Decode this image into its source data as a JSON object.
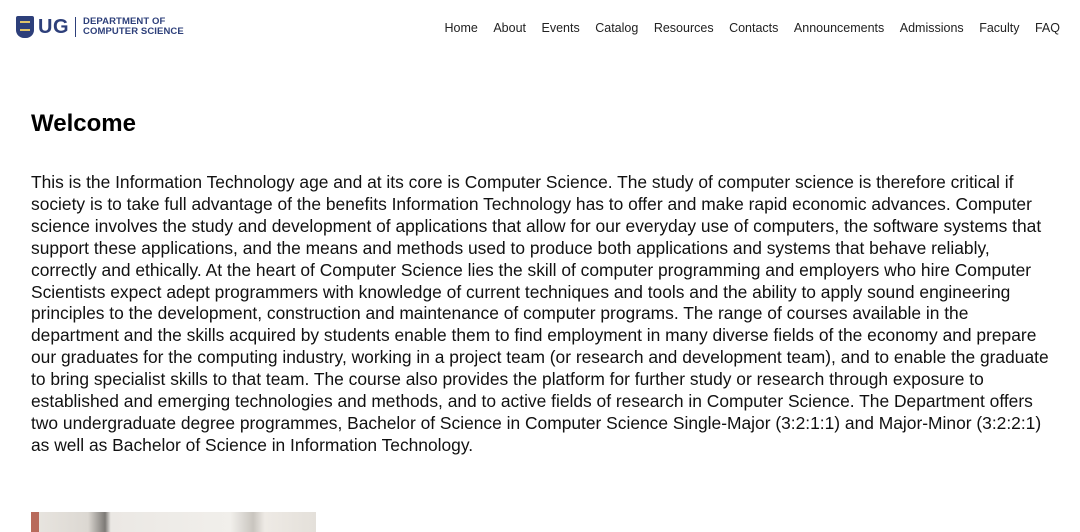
{
  "header": {
    "logo_mark": "UG",
    "logo_line1": "DEPARTMENT OF",
    "logo_line2": "COMPUTER SCIENCE",
    "nav": [
      {
        "label": "Home"
      },
      {
        "label": "About"
      },
      {
        "label": "Events"
      },
      {
        "label": "Catalog"
      },
      {
        "label": "Resources"
      },
      {
        "label": "Contacts"
      },
      {
        "label": "Announcements"
      },
      {
        "label": "Admissions"
      },
      {
        "label": "Faculty"
      },
      {
        "label": "FAQ"
      }
    ]
  },
  "main": {
    "title": "Welcome",
    "body": "This is the Information Technology age and at its core is Computer Science. The study of computer science is therefore critical if society is to take full advantage of the benefits Information Technology has to offer and make rapid economic advances. Computer science involves the study and development of applications that allow for our everyday use of computers, the software systems that support these applications, and the means and methods used to produce both applications and systems that behave reliably, correctly and ethically. At the heart of Computer Science lies the skill of computer programming and employers who hire Computer Scientists expect adept programmers with knowledge of current techniques and tools and the ability to apply sound engineering principles to the development, construction and maintenance of computer programs. The range of courses available in the department and the skills acquired by students enable them to find employment in many diverse fields of the economy and prepare our graduates for the computing industry, working in a project team (or research and development team), and to enable the graduate to bring specialist skills to that team. The course also provides the platform for further study or research through exposure to established and emerging technologies and methods, and to active fields of research in Computer Science. The Department offers two undergraduate degree programmes, Bachelor of Science in Computer Science Single-Major (3:2:1:1) and Major-Minor (3:2:2:1) as well as Bachelor of Science in Information Technology."
  },
  "colors": {
    "brand": "#2d3f7a",
    "accent": "#e0c46a"
  },
  "icons": {
    "logo": "university-crest-icon"
  }
}
